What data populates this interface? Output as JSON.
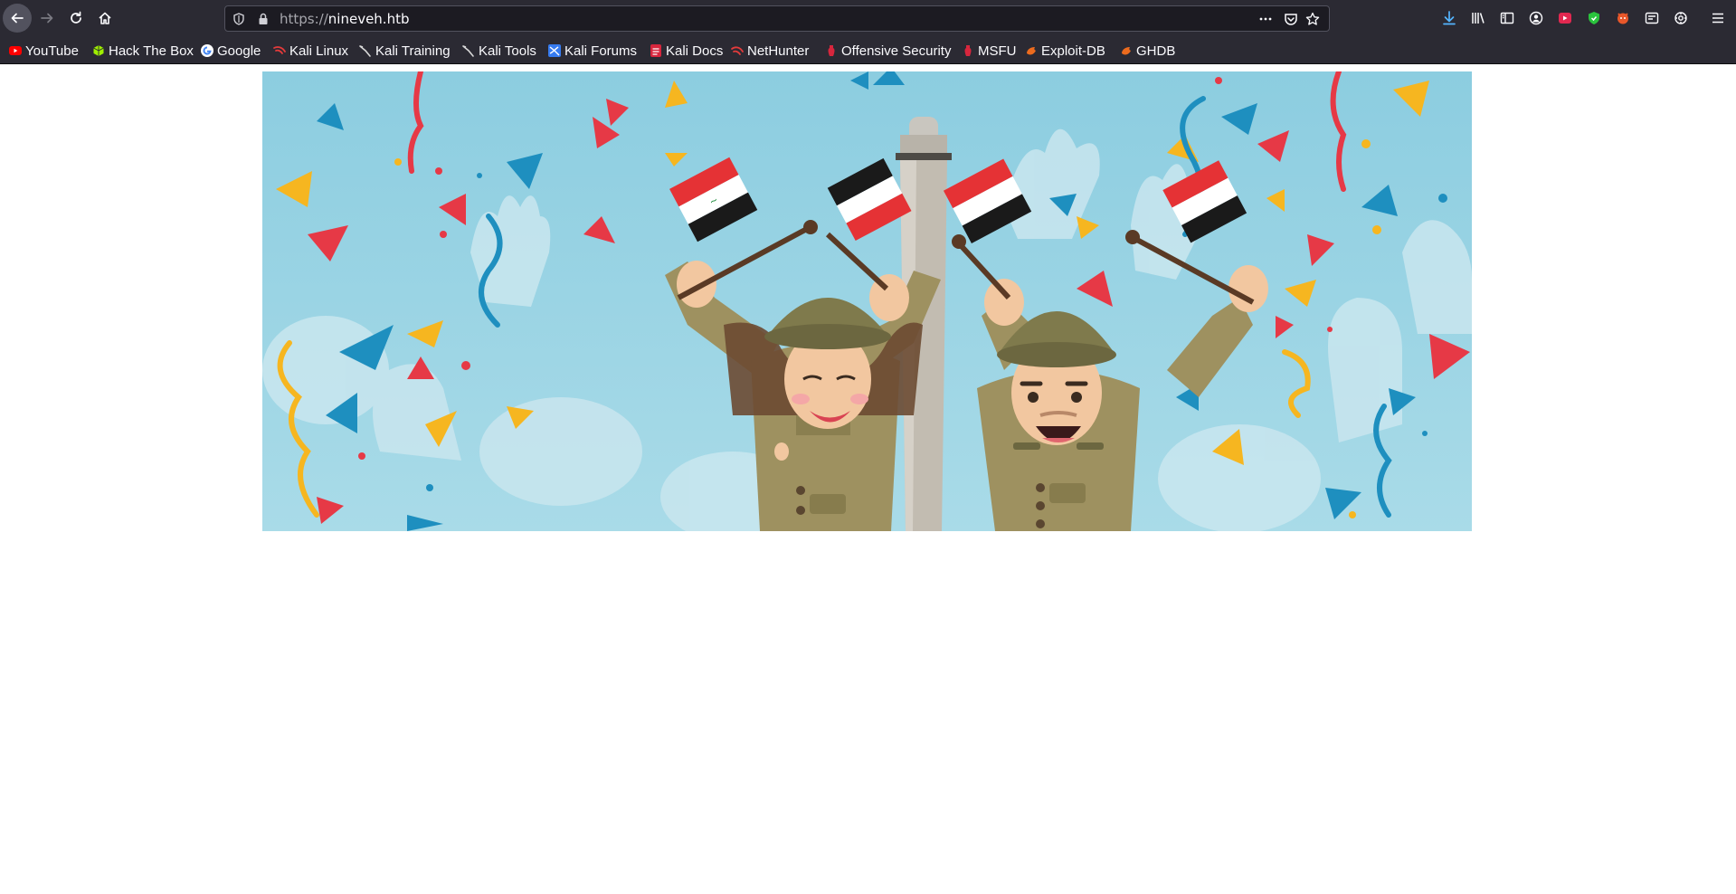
{
  "browser": {
    "url_scheme": "https://",
    "url_host": "nineveh.htb"
  },
  "bookmarks": [
    {
      "label": "YouTube",
      "icon": "youtube-icon"
    },
    {
      "label": "Hack The Box",
      "icon": "hackthebox-icon"
    },
    {
      "label": "Google",
      "icon": "google-icon"
    },
    {
      "label": "Kali Linux",
      "icon": "kali-dragon-icon"
    },
    {
      "label": "Kali Training",
      "icon": "kali-dragon-icon"
    },
    {
      "label": "Kali Tools",
      "icon": "kali-dragon-icon"
    },
    {
      "label": "Kali Forums",
      "icon": "kali-forums-icon"
    },
    {
      "label": "Kali Docs",
      "icon": "kali-docs-icon"
    },
    {
      "label": "NetHunter",
      "icon": "nethunter-icon"
    },
    {
      "label": "Offensive Security",
      "icon": "offsec-icon"
    },
    {
      "label": "MSFU",
      "icon": "msfu-icon"
    },
    {
      "label": "Exploit-DB",
      "icon": "exploitdb-icon"
    },
    {
      "label": "GHDB",
      "icon": "ghdb-icon"
    }
  ],
  "colors": {
    "toolbar_bg": "#2b2a33",
    "urlbar_bg": "#1c1b22",
    "banner_sky": "#8ccde0",
    "uniform": "#9e9160",
    "helmet": "#7f7a4c",
    "flag_red": "#e53235",
    "flag_black": "#1a1a1a",
    "confetti_blue": "#1e8fbf",
    "confetti_yellow": "#f6b620"
  }
}
